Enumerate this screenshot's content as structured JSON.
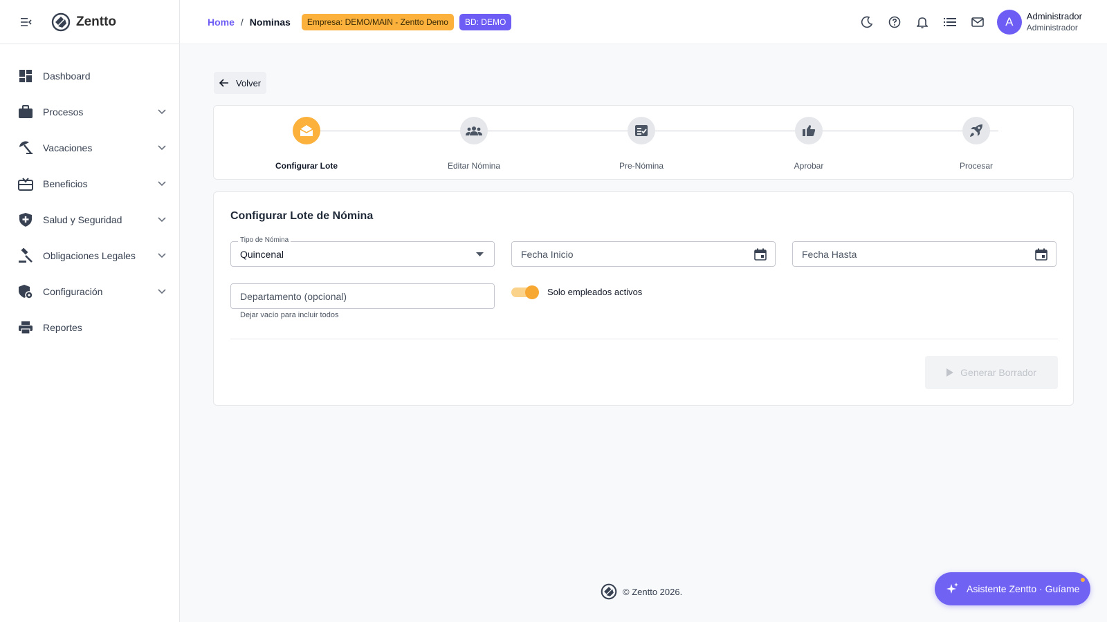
{
  "app": {
    "name": "Zentto"
  },
  "sidebar": {
    "items": [
      {
        "label": "Dashboard",
        "icon": "dashboard-icon",
        "expandable": false
      },
      {
        "label": "Procesos",
        "icon": "briefcase-icon",
        "expandable": true
      },
      {
        "label": "Vacaciones",
        "icon": "beach-umbrella-icon",
        "expandable": true
      },
      {
        "label": "Beneficios",
        "icon": "gift-card-icon",
        "expandable": true
      },
      {
        "label": "Salud y Seguridad",
        "icon": "health-shield-icon",
        "expandable": true
      },
      {
        "label": "Obligaciones Legales",
        "icon": "gavel-icon",
        "expandable": true
      },
      {
        "label": "Configuración",
        "icon": "admin-shield-icon",
        "expandable": true
      },
      {
        "label": "Reportes",
        "icon": "printer-icon",
        "expandable": false
      }
    ]
  },
  "header": {
    "breadcrumb": {
      "home": "Home",
      "separator": "/",
      "current": "Nominas"
    },
    "empresa_badge": "Empresa: DEMO/MAIN - Zentto Demo",
    "bd_badge": "BD: DEMO",
    "icons": [
      "moon-icon",
      "help-icon",
      "bell-icon",
      "list-icon",
      "mail-icon"
    ],
    "user": {
      "initial": "A",
      "name": "Administrador",
      "role": "Administrador"
    }
  },
  "main": {
    "back_label": "Volver",
    "steps": [
      {
        "label": "Configurar Lote",
        "icon": "envelope-open-icon",
        "active": true
      },
      {
        "label": "Editar Nómina",
        "icon": "group-icon",
        "active": false
      },
      {
        "label": "Pre-Nómina",
        "icon": "checklist-icon",
        "active": false
      },
      {
        "label": "Aprobar",
        "icon": "thumbs-up-icon",
        "active": false
      },
      {
        "label": "Procesar",
        "icon": "rocket-icon",
        "active": false
      }
    ],
    "form": {
      "title": "Configurar Lote de Nómina",
      "tipo": {
        "label": "Tipo de Nómina",
        "value": "Quincenal"
      },
      "fecha_inicio": {
        "placeholder": "Fecha Inicio"
      },
      "fecha_hasta": {
        "placeholder": "Fecha Hasta"
      },
      "departamento": {
        "placeholder": "Departamento (opcional)",
        "helper": "Dejar vacío para incluir todos"
      },
      "solo_activos": {
        "label": "Solo empleados activos",
        "checked": true
      },
      "generate_label": "Generar Borrador"
    }
  },
  "footer": {
    "text": "© Zentto 2026."
  },
  "assistant": {
    "label": "Asistente Zentto · Guíame"
  },
  "colors": {
    "accent": "#6d5df4",
    "warning": "#fbb13c"
  }
}
